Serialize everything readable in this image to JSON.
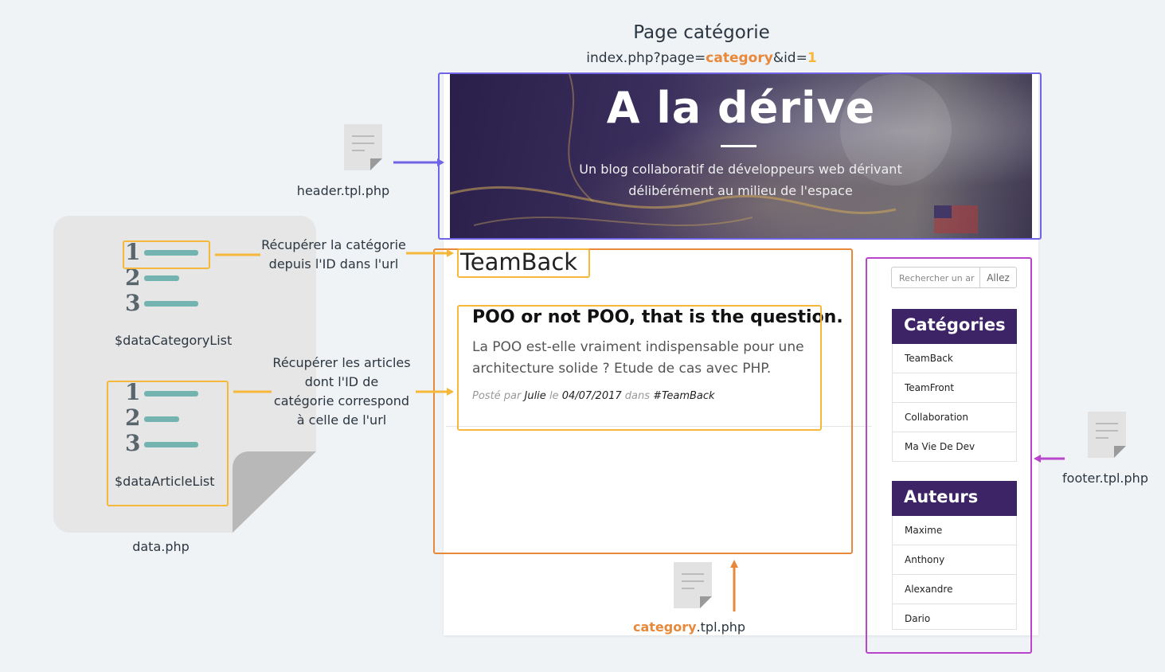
{
  "page": {
    "title": "Page catégorie",
    "url_prefix": "index.php?page=",
    "url_page": "category",
    "url_mid": "&id=",
    "url_id": "1"
  },
  "hero": {
    "title": "A la dérive",
    "subtitle": "Un blog collaboratif de développeurs web dérivant délibérément au milieu de l'espace"
  },
  "category": {
    "name": "TeamBack",
    "post": {
      "title": "POO or not POO, that is the question.",
      "excerpt": "La POO est-elle vraiment indispensable pour une architecture solide ? Etude de cas avec PHP.",
      "meta_posted": "Posté par",
      "author": "Julie",
      "meta_on": "le",
      "date": "04/07/2017",
      "meta_in": "dans",
      "tag": "#TeamBack"
    }
  },
  "sidebar": {
    "search_placeholder": "Rechercher un ar",
    "search_button": "Allez",
    "categories_title": "Catégories",
    "categories": [
      "TeamBack",
      "TeamFront",
      "Collaboration",
      "Ma Vie De Dev"
    ],
    "authors_title": "Auteurs",
    "authors": [
      "Maxime",
      "Anthony",
      "Alexandre",
      "Dario"
    ]
  },
  "files": {
    "header": "header.tpl.php",
    "category_highlight": "category",
    "category_rest": ".tpl.php",
    "footer": "footer.tpl.php",
    "data": "data.php"
  },
  "lists": {
    "category_list": "$dataCategoryList",
    "article_list": "$dataArticleList",
    "numbers": [
      "1",
      "2",
      "3"
    ]
  },
  "notes": {
    "category_note": [
      "Récupérer la catégorie",
      "depuis l'ID dans l'url"
    ],
    "articles_note": [
      "Récupérer les articles",
      "dont l'ID de",
      "catégorie correspond",
      "à celle de l'url"
    ]
  },
  "colors": {
    "header_box": "#7064e6",
    "category_box": "#e8883a",
    "footer_box": "#bb44cc",
    "highlight_box": "#f5b83a",
    "panel_head": "#3d2466",
    "list_bar": "#74b4b0",
    "list_number": "#59656d"
  }
}
